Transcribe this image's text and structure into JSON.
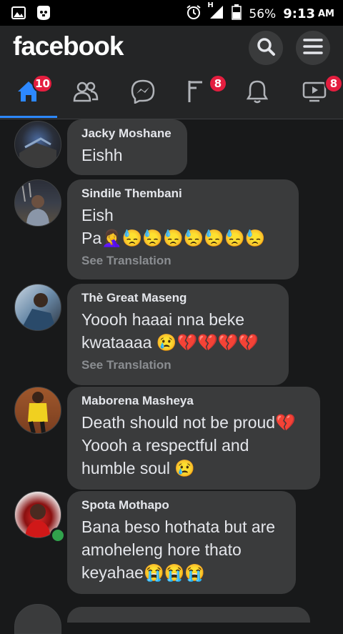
{
  "status_bar": {
    "signal_label": "H",
    "battery": "56%",
    "time": "9:13",
    "ampm": "AM"
  },
  "header": {
    "logo": "facebook"
  },
  "tabs": [
    {
      "name": "home",
      "badge": "10"
    },
    {
      "name": "friends",
      "badge": ""
    },
    {
      "name": "messenger",
      "badge": ""
    },
    {
      "name": "pages",
      "badge": "8"
    },
    {
      "name": "notifications",
      "badge": ""
    },
    {
      "name": "watch",
      "badge": "8"
    }
  ],
  "comments": [
    {
      "author": "Jacky Moshane",
      "text": "Eishh",
      "translate": ""
    },
    {
      "author": "Sindile Thembani",
      "text": "Eish\nPa🤦‍♀️😓😓😓😓😓😓😓",
      "translate": "See Translation"
    },
    {
      "author": "Thè Great Maseng",
      "text": "Yoooh haaai nna beke\nkwataaaa 😢💔💔💔💔",
      "translate": "See Translation"
    },
    {
      "author": "Maborena Masheya",
      "text": "Death should not be proud💔\nYoooh a respectful and\nhumble soul 😢",
      "translate": ""
    },
    {
      "author": "Spota Mothapo",
      "text": "Bana beso hothata but are\namoheleng hore thato\nkeyahae😭😭😭",
      "translate": ""
    }
  ]
}
